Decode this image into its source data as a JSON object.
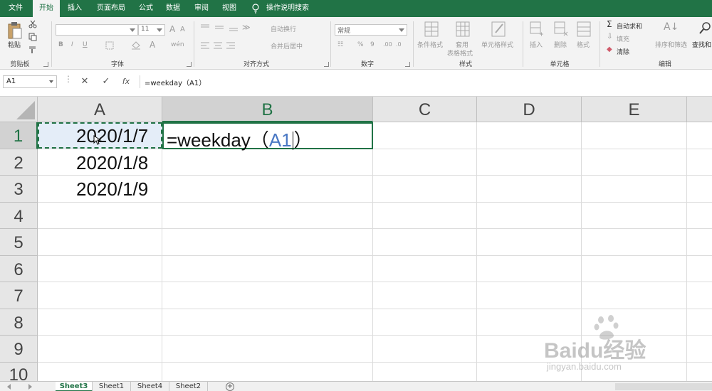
{
  "menubar": {
    "tabs": [
      {
        "label": "文件",
        "active": false
      },
      {
        "label": "开始",
        "active": true
      },
      {
        "label": "插入",
        "active": false
      },
      {
        "label": "页面布局",
        "active": false
      },
      {
        "label": "公式",
        "active": false
      },
      {
        "label": "数据",
        "active": false
      },
      {
        "label": "审阅",
        "active": false
      },
      {
        "label": "视图",
        "active": false
      }
    ],
    "search_label": "操作说明搜索",
    "accent": "#217346"
  },
  "ribbon": {
    "clipboard": {
      "paste": "粘贴",
      "label": "剪贴板"
    },
    "font": {
      "name": "",
      "size": "11",
      "bold": "B",
      "italic": "I",
      "underline": "U",
      "label": "字体"
    },
    "alignment": {
      "wrap": "自动换行",
      "merge": "合并后居中",
      "label": "对齐方式"
    },
    "number": {
      "format": "常规",
      "percent": "%",
      "comma": "9",
      "label": "数字"
    },
    "styles": {
      "conditional": "条件格式",
      "table_line1": "套用",
      "table_line2": "表格格式",
      "cell_styles": "单元格样式",
      "label": "样式"
    },
    "cells": {
      "insert": "插入",
      "delete": "删除",
      "format": "格式",
      "label": "单元格"
    },
    "editing": {
      "autosum": "自动求和",
      "fill": "填充",
      "clear": "清除",
      "sort": "排序和筛选",
      "find": "查找和",
      "label": "编辑"
    }
  },
  "formula_bar": {
    "name_box": "A1",
    "cancel": "✕",
    "enter": "✓",
    "fx": "fx",
    "formula": "=weekday（A1）"
  },
  "grid": {
    "columns": [
      "A",
      "B",
      "C",
      "D",
      "E"
    ],
    "rows": [
      "1",
      "2",
      "3",
      "4",
      "5",
      "6",
      "7",
      "8",
      "9",
      "10"
    ],
    "cells": {
      "A1": "2020/1/7",
      "A2": "2020/1/8",
      "A3": "2020/1/9"
    },
    "edit_cell": {
      "prefix": "=weekday（",
      "ref": "A1",
      "suffix": "）"
    },
    "selected_column": "B",
    "selected_row": "1"
  },
  "sheets": [
    "Sheet3",
    "Sheet1",
    "Sheet4",
    "Sheet2"
  ],
  "active_sheet": "Sheet3",
  "watermark": {
    "brand": "Baidu经验",
    "url": "jingyan.baidu.com"
  }
}
